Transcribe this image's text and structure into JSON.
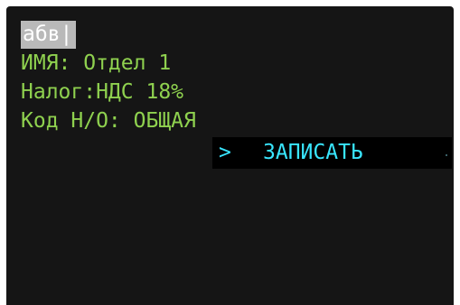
{
  "input_line": {
    "text": "абв",
    "cursor": "|"
  },
  "fields": {
    "name": "ИМЯ: Отдел 1",
    "tax": "Налог:НДС 18%",
    "code": "Код Н/О: ОБЩАЯ"
  },
  "menu": {
    "pointer": ">",
    "selected_label": "ЗАПИСАТЬ"
  },
  "colors": {
    "background": "#151515",
    "field_text": "#8fd14f",
    "menu_text": "#39e6ff",
    "menu_background": "#000000",
    "input_highlight": "#b9b9b9"
  }
}
